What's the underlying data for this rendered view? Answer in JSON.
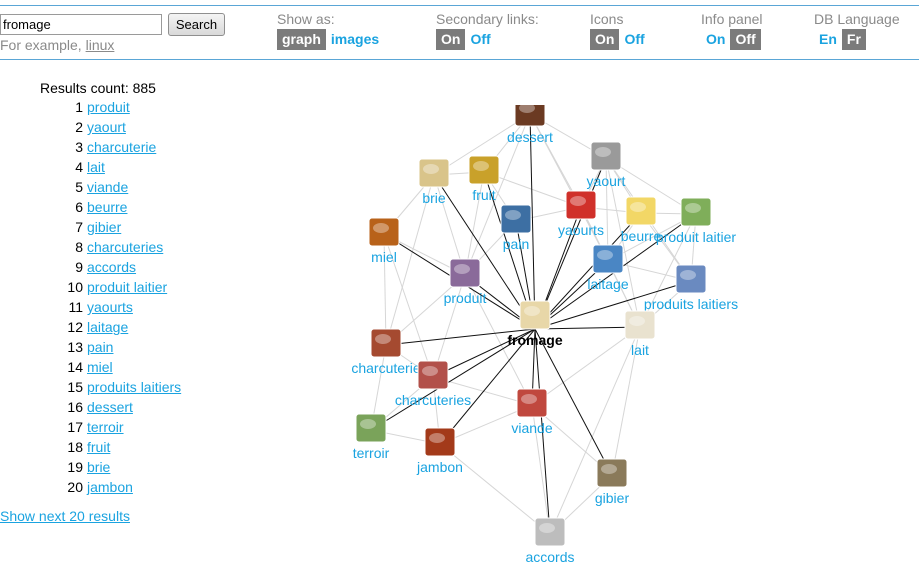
{
  "search": {
    "value": "fromage",
    "button_label": "Search",
    "example_prefix": "For example, ",
    "example_link": "linux"
  },
  "options": [
    {
      "label": "Show as:",
      "values": [
        {
          "text": "graph",
          "selected": true
        },
        {
          "text": "images",
          "selected": false
        }
      ]
    },
    {
      "label": "Secondary links:",
      "values": [
        {
          "text": "On",
          "selected": true
        },
        {
          "text": "Off",
          "selected": false
        }
      ]
    },
    {
      "label": "Icons",
      "values": [
        {
          "text": "On",
          "selected": true
        },
        {
          "text": "Off",
          "selected": false
        }
      ]
    },
    {
      "label": "Info panel",
      "values": [
        {
          "text": "On",
          "selected": false
        },
        {
          "text": "Off",
          "selected": true
        }
      ]
    },
    {
      "label": "DB Language",
      "values": [
        {
          "text": "En",
          "selected": false
        },
        {
          "text": "Fr",
          "selected": true
        }
      ]
    }
  ],
  "results": {
    "count_label": "Results count: 885",
    "items": [
      {
        "num": "1",
        "label": "produit"
      },
      {
        "num": "2",
        "label": "yaourt"
      },
      {
        "num": "3",
        "label": "charcuterie"
      },
      {
        "num": "4",
        "label": "lait"
      },
      {
        "num": "5",
        "label": "viande"
      },
      {
        "num": "6",
        "label": "beurre"
      },
      {
        "num": "7",
        "label": "gibier"
      },
      {
        "num": "8",
        "label": "charcuteries"
      },
      {
        "num": "9",
        "label": "accords"
      },
      {
        "num": "10",
        "label": "produit laitier"
      },
      {
        "num": "11",
        "label": "yaourts"
      },
      {
        "num": "12",
        "label": "laitage"
      },
      {
        "num": "13",
        "label": "pain"
      },
      {
        "num": "14",
        "label": "miel"
      },
      {
        "num": "15",
        "label": "produits laitiers"
      },
      {
        "num": "16",
        "label": "dessert"
      },
      {
        "num": "17",
        "label": "terroir"
      },
      {
        "num": "18",
        "label": "fruit"
      },
      {
        "num": "19",
        "label": "brie"
      },
      {
        "num": "20",
        "label": "jambon"
      }
    ],
    "show_next": "Show next 20 results"
  },
  "graph": {
    "center": {
      "label": "fromage",
      "icon": "cheese-icon"
    },
    "nodes": [
      {
        "label": "dessert",
        "icon": "dessert-icon",
        "color": "#6b3a22"
      },
      {
        "label": "yaourt",
        "icon": "yogurt-icon",
        "color": "#9a9a9a"
      },
      {
        "label": "brie",
        "icon": "brie-icon",
        "color": "#d9c48a"
      },
      {
        "label": "fruit",
        "icon": "fruit-icon",
        "color": "#c9a12a"
      },
      {
        "label": "yaourts",
        "icon": "yogurts-icon",
        "color": "#d0302a"
      },
      {
        "label": "beurre",
        "icon": "butter-icon",
        "color": "#f2d766"
      },
      {
        "label": "produit laitier",
        "icon": "dairy-product-icon",
        "color": "#7fae5a"
      },
      {
        "label": "miel",
        "icon": "honey-icon",
        "color": "#b8621a"
      },
      {
        "label": "pain",
        "icon": "bread-icon",
        "color": "#3d6fa3"
      },
      {
        "label": "laitage",
        "icon": "dairy-icon",
        "color": "#4a86c4"
      },
      {
        "label": "produit",
        "icon": "product-bottles-icon",
        "color": "#8a6a9a"
      },
      {
        "label": "produits laitiers",
        "icon": "dairy-products-icon",
        "color": "#6a8ac0"
      },
      {
        "label": "lait",
        "icon": "milk-icon",
        "color": "#e9e2cf"
      },
      {
        "label": "charcuterie",
        "icon": "charcuterie-icon",
        "color": "#a54a30"
      },
      {
        "label": "charcuteries",
        "icon": "charcuteries-icon",
        "color": "#b2504a"
      },
      {
        "label": "viande",
        "icon": "meat-icon",
        "color": "#c0483e"
      },
      {
        "label": "terroir",
        "icon": "terroir-icon",
        "color": "#7aa35a"
      },
      {
        "label": "jambon",
        "icon": "ham-icon",
        "color": "#a33a1a"
      },
      {
        "label": "gibier",
        "icon": "game-icon",
        "color": "#8a7a5a"
      },
      {
        "label": "accords",
        "icon": "accords-icon",
        "color": "#bdbdbd"
      }
    ]
  }
}
